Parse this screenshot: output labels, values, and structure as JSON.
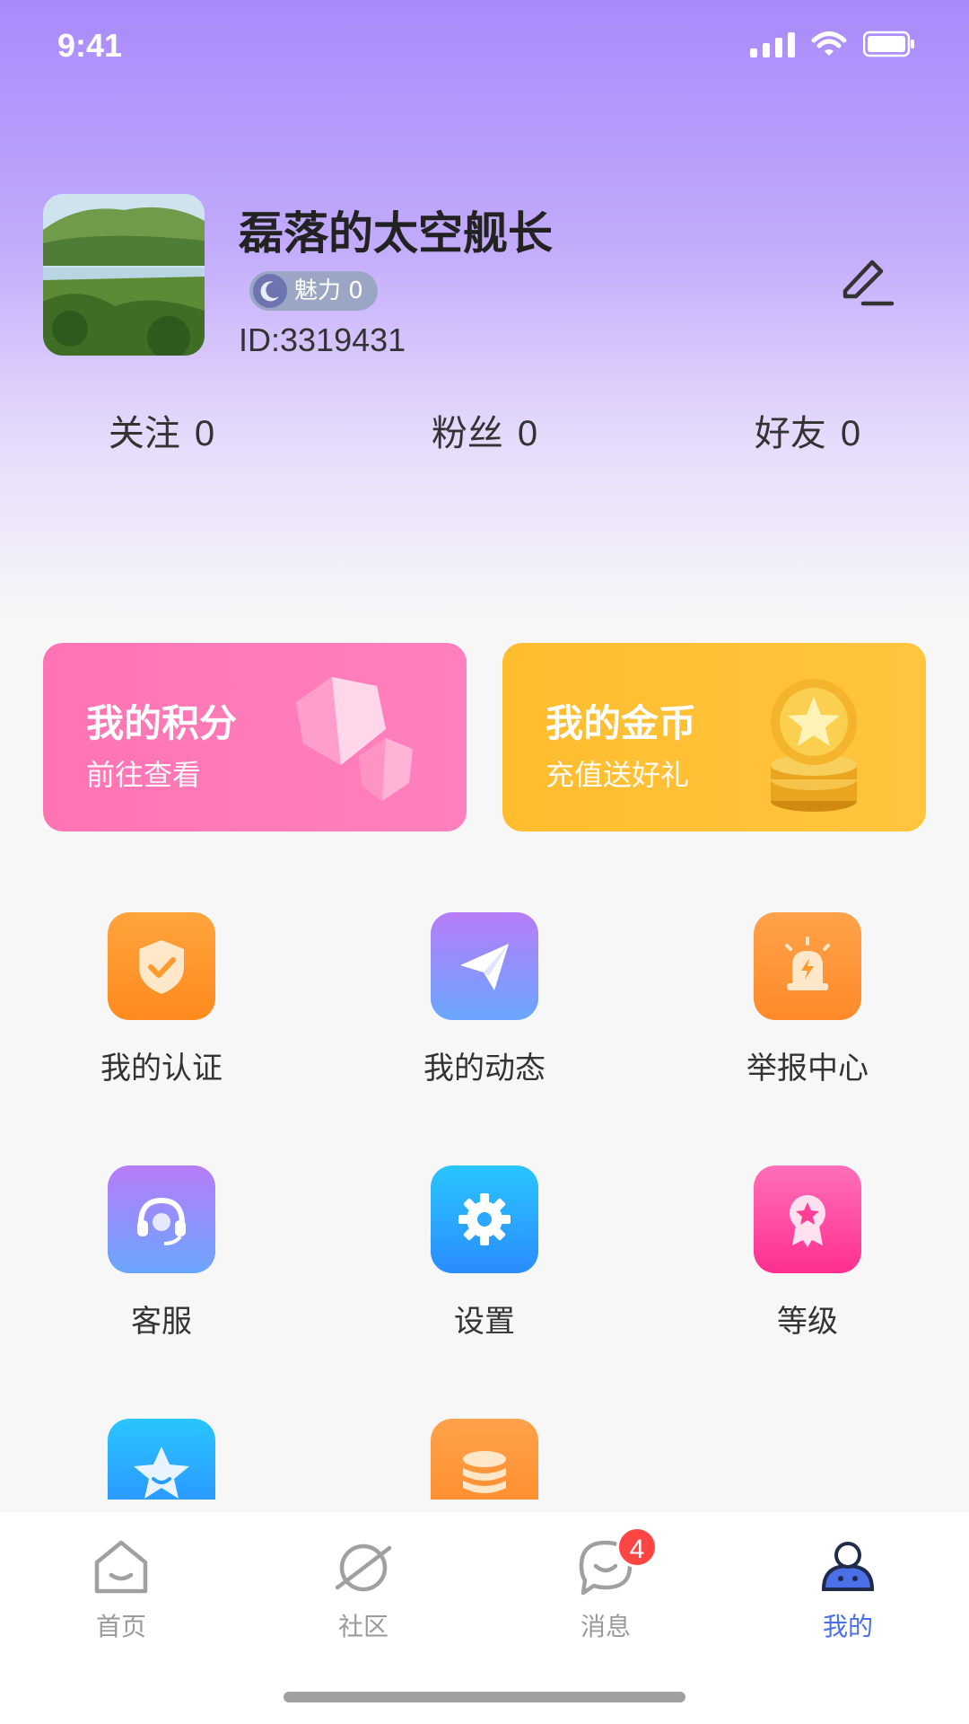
{
  "status_bar": {
    "time": "9:41"
  },
  "profile": {
    "nickname": "磊落的太空舰长",
    "charm": "魅力 0",
    "user_id": "ID:3319431"
  },
  "stats": [
    {
      "label": "关注",
      "value": "0"
    },
    {
      "label": "粉丝",
      "value": "0"
    },
    {
      "label": "好友",
      "value": "0"
    }
  ],
  "cards": {
    "points": {
      "title": "我的积分",
      "subtitle": "前往查看"
    },
    "coins": {
      "title": "我的金币",
      "subtitle": "充值送好礼"
    }
  },
  "menu": [
    {
      "label": "我的认证",
      "icon": "shield-check-icon"
    },
    {
      "label": "我的动态",
      "icon": "paper-plane-icon"
    },
    {
      "label": "举报中心",
      "icon": "alarm-icon"
    },
    {
      "label": "客服",
      "icon": "headset-icon"
    },
    {
      "label": "设置",
      "icon": "gear-icon"
    },
    {
      "label": "等级",
      "icon": "medal-icon"
    },
    {
      "label": "",
      "icon": "star-smile-icon"
    },
    {
      "label": "",
      "icon": "coin-stack-icon"
    }
  ],
  "tabbar": {
    "items": [
      {
        "label": "首页",
        "icon": "home-icon"
      },
      {
        "label": "社区",
        "icon": "planet-icon"
      },
      {
        "label": "消息",
        "icon": "message-icon",
        "badge": "4"
      },
      {
        "label": "我的",
        "icon": "profile-icon",
        "active": true
      }
    ]
  },
  "colors": {
    "header_top": "#a98afb",
    "points_card": "#ff74b3",
    "coins_card": "#ffbd2f",
    "active_tab": "#4a6fe6",
    "badge": "#ff4444"
  }
}
